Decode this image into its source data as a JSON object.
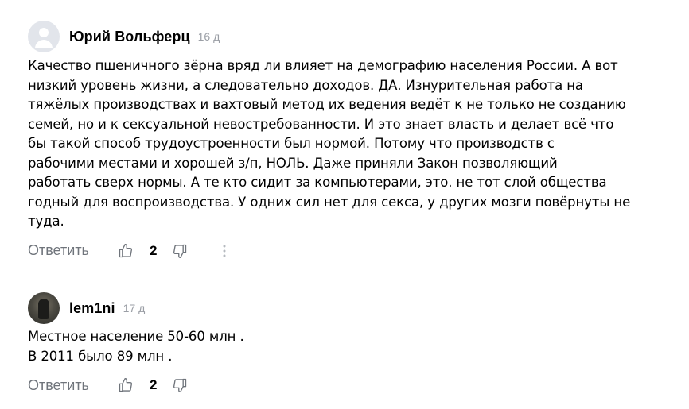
{
  "comments": [
    {
      "author": "Юрий Вольферц",
      "age": "16 д",
      "avatar": "default-user-avatar",
      "text": "Качество пшеничного зёрна вряд ли влияет на демографию населения России. А вот\nнизкий уровень жизни, а следовательно доходов. ДА. Изнурительная работа на\nтяжёлых производствах и вахтовый метод их ведения ведёт к не только не созданию\nсемей, но и к сексуальной невостребованности. И это знает власть и делает всё что\nбы такой способ трудоустроенности был нормой. Потому что производств с\nрабочими местами и хорошей з/п, НОЛЬ. Даже приняли Закон позволяющий\nработать сверх нормы. А те кто сидит за компьютерами, это. не тот слой общества\nгодный для воспроизводства. У одних сил нет для секса, у других мозги повёрнуты не\nтуда.",
      "reply_label": "Ответить",
      "likes": "2"
    },
    {
      "author": "lem1ni",
      "age": "17 д",
      "avatar": "user-photo-avatar",
      "text": "Местное население 50-60 млн .\nВ 2011 было 89 млн .",
      "reply_label": "Ответить",
      "likes": "2"
    }
  ],
  "icons": {
    "like": "thumbs-up-icon",
    "dislike": "thumbs-down-icon",
    "more": "more-vertical-icon"
  },
  "colors": {
    "muted_text": "#6f747b",
    "timestamp": "#9a9ea5",
    "avatar_bg": "#e2e5eb",
    "icon_stroke": "#6f747b"
  }
}
